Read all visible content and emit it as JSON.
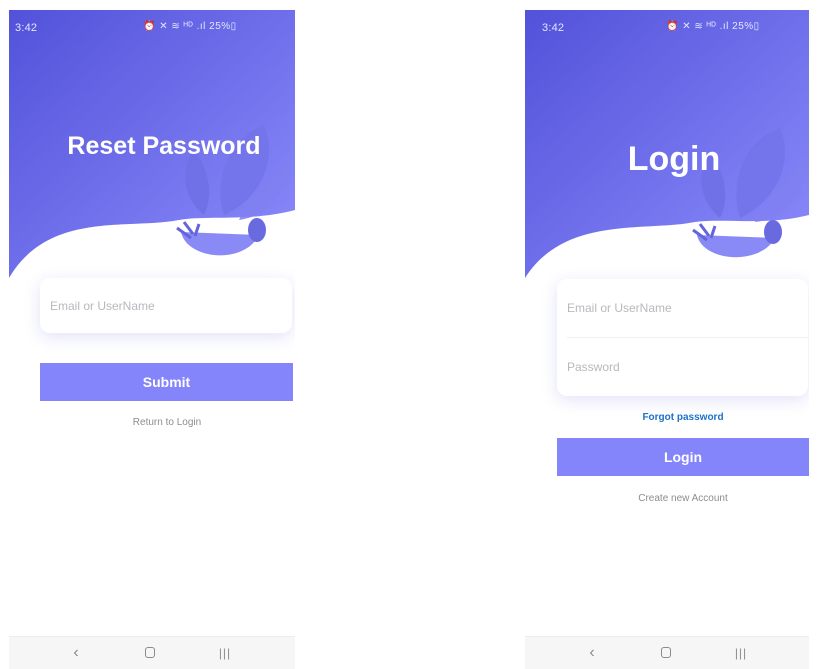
{
  "colors": {
    "gradient_top": "#5757de",
    "gradient_bottom": "#8989fb",
    "plant": "#7b7bf0",
    "button": "#8585fb",
    "link_blue": "#1e70c8",
    "muted_text": "#8c8c92"
  },
  "status_bar": {
    "time": "3:42",
    "icons": "⏰ ✕ ≋ ᴴᴰ .ıl 25%▯"
  },
  "reset_screen": {
    "title": "Reset Password",
    "email_placeholder": "Email or UserName",
    "submit_label": "Submit",
    "return_label": "Return to Login"
  },
  "login_screen": {
    "title": "Login",
    "email_placeholder": "Email or UserName",
    "password_placeholder": "Password",
    "forgot_label": "Forgot password",
    "login_label": "Login",
    "create_label": "Create new Account"
  },
  "nav_bar": {
    "back_icon": "‹",
    "recent_icon": "|||"
  }
}
